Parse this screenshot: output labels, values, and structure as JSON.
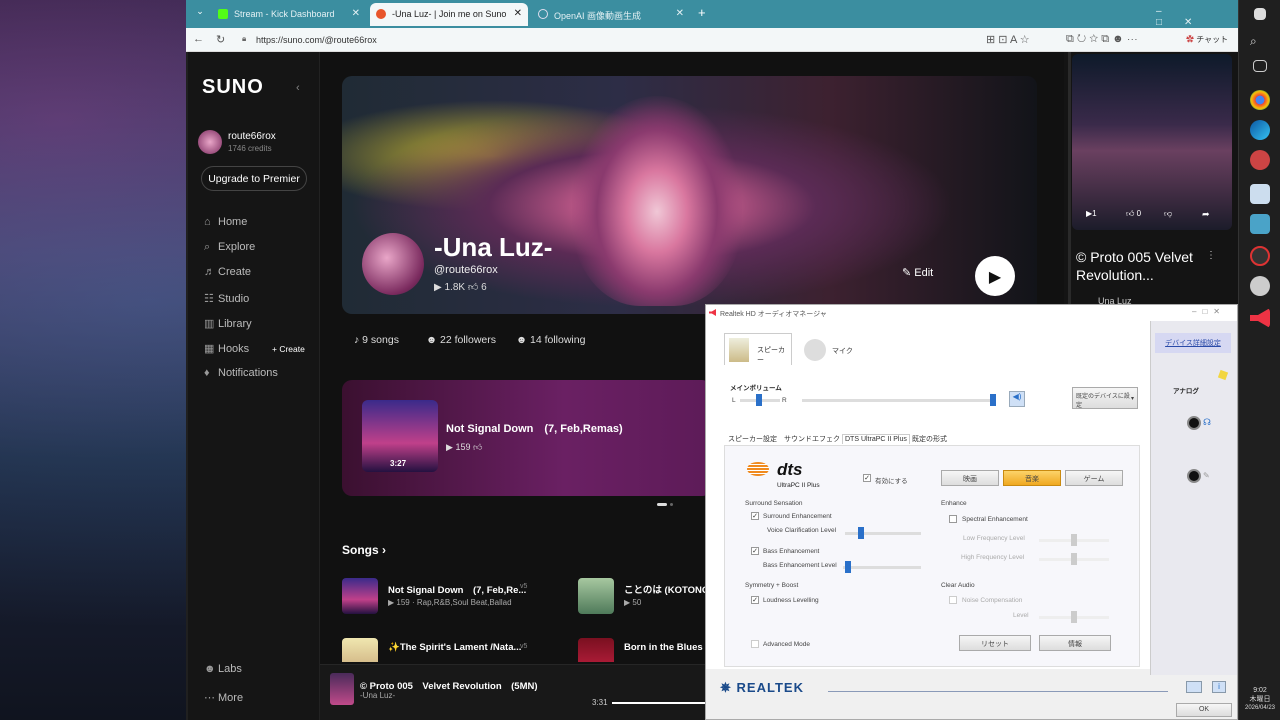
{
  "browser": {
    "tabs": [
      {
        "label": "Stream - Kick Dashboard",
        "active": false
      },
      {
        "label": "-Una Luz- | Join me on Suno",
        "active": true
      },
      {
        "label": "OpenAI 画像動画生成",
        "active": false
      }
    ],
    "url": "https://suno.com/@route66rox",
    "copilot_label": "チャット"
  },
  "sidebar": {
    "logo": "SUNO",
    "user": {
      "name": "route66rox",
      "credits": "1746 credits"
    },
    "upgrade_label": "Upgrade to Premier",
    "items": [
      {
        "label": "Home",
        "icon": "home-icon"
      },
      {
        "label": "Explore",
        "icon": "compass-icon"
      },
      {
        "label": "Create",
        "icon": "music-note-icon"
      },
      {
        "label": "Studio",
        "icon": "sliders-icon"
      },
      {
        "label": "Library",
        "icon": "library-icon"
      },
      {
        "label": "Hooks",
        "icon": "hook-icon"
      },
      {
        "label": "Notifications",
        "icon": "bell-icon"
      }
    ],
    "hooks_create_label": "+ Create",
    "bottom_items": [
      {
        "label": "Labs",
        "icon": "person-icon"
      },
      {
        "label": "More",
        "icon": "more-icon"
      }
    ]
  },
  "profile": {
    "name": "-Una Luz-",
    "handle": "@route66rox",
    "plays": "1.8K",
    "likes": "6",
    "edit_label": "Edit",
    "songs_count": "9 songs",
    "followers": "22 followers",
    "following": "14 following"
  },
  "featured": {
    "title": "Not Signal Down　(7, Feb,Remas)",
    "plays": "159",
    "duration": "3:27"
  },
  "songs_header": "Songs",
  "songs": [
    {
      "title": "Not Signal Down　(7, Feb,Re...",
      "meta": "159 · Rap,R&B,Soul Beat,Ballad",
      "version": "v5"
    },
    {
      "title": "ことのは (KOTONOHA",
      "meta": "50",
      "version": ""
    },
    {
      "title": "✨The Spirit's Lament /Nata...",
      "meta": "",
      "version": "v5"
    },
    {
      "title": "Born in the Blues /Ja",
      "meta": "",
      "version": ""
    }
  ],
  "player": {
    "title": "© Proto 005　Velvet Revolution　(5MN)",
    "artist": "-Una Luz-",
    "time": "3:31"
  },
  "right_card": {
    "title": "© Proto 005 Velvet Revolution...",
    "artist": "Una Luz",
    "likes": "0"
  },
  "realtek": {
    "window_title": "Realtek HD オーディオマネージャ",
    "tab_speaker": "スピーカー",
    "tab_mic": "マイク",
    "main_volume": "メインボリューム",
    "vol_l": "L",
    "vol_r": "R",
    "default_device": "既定のデバイスに設定",
    "subtabs": [
      "スピーカー設定",
      "サウンドエフェクト",
      "DTS UltraPC II Plus",
      "既定の形式"
    ],
    "dts_logo": "dts",
    "dts_sub": "UltraPC II Plus",
    "enable_label": "有効にする",
    "modes": [
      {
        "label": "映画",
        "selected": false
      },
      {
        "label": "音楽",
        "selected": true
      },
      {
        "label": "ゲーム",
        "selected": false
      }
    ],
    "surround_header": "Surround Sensation",
    "surround_enh": "Surround Enhancement",
    "voice_clarification": "Voice Clarification Level",
    "bass_enh": "Bass Enhancement",
    "bass_level": "Bass Enhancement Level",
    "symmetry_header": "Symmetry + Boost",
    "loudness": "Loudness Levelling",
    "enhance_header": "Enhance",
    "spectral": "Spectral Enhancement",
    "low_freq": "Low Frequency Level",
    "high_freq": "High Frequency Level",
    "clear_audio_header": "Clear Audio",
    "noise_comp": "Noise Compensation",
    "level": "Level",
    "advanced_mode": "Advanced Mode",
    "reset_label": "リセット",
    "info_label": "情報",
    "device_settings": "デバイス詳細設定",
    "analog_label": "アナログ",
    "realtek_logo": "REALTEK",
    "ok_label": "OK"
  },
  "clock": {
    "time": "9:02",
    "day": "木曜日",
    "date": "2026/04/23"
  }
}
